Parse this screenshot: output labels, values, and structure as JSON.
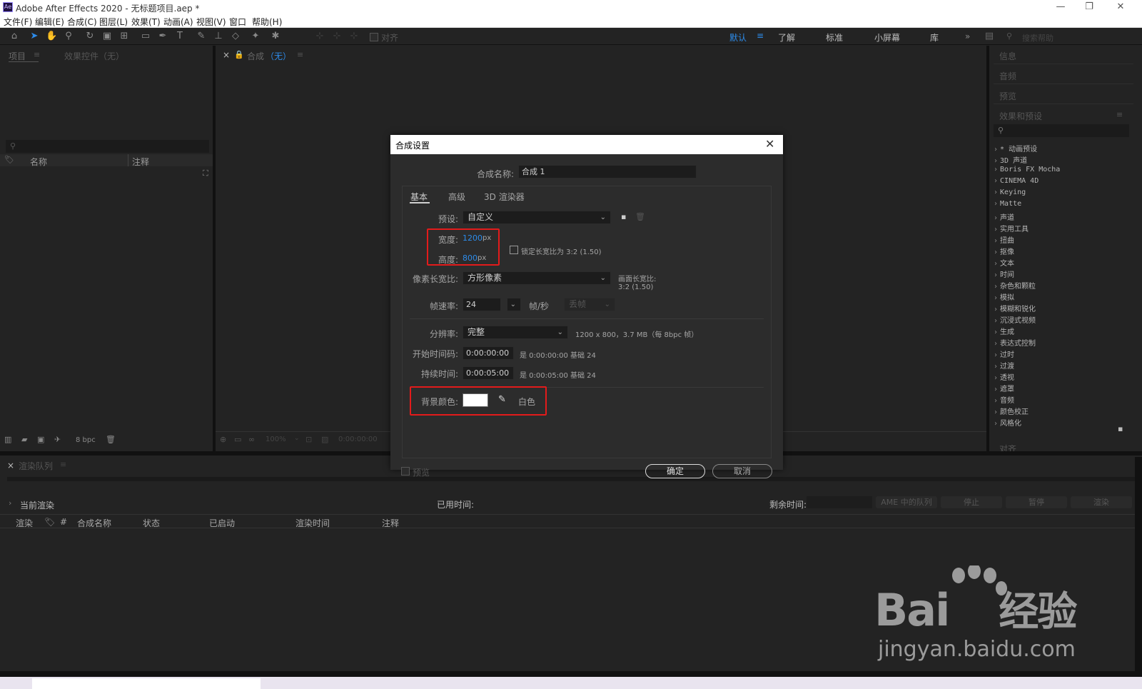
{
  "window": {
    "title": "Adobe After Effects 2020 - 无标题项目.aep *",
    "logo": "Ae"
  },
  "menu": [
    "文件(F)",
    "编辑(E)",
    "合成(C)",
    "图层(L)",
    "效果(T)",
    "动画(A)",
    "视图(V)",
    "窗口",
    "帮助(H)"
  ],
  "toolbar": {
    "align_label": "对齐",
    "workspaces": [
      "默认",
      "了解",
      "标准",
      "小屏幕",
      "库"
    ],
    "search_placeholder": "搜索帮助"
  },
  "project_panel": {
    "tab_project": "项目",
    "tab_effects": "效果控件（无）",
    "col_name": "名称",
    "col_comment": "注释",
    "bpc": "8 bpc"
  },
  "comp_panel": {
    "tab_label": "合成",
    "tab_value": "（无）",
    "zoom": "100%",
    "timecode": "0:00:00:00"
  },
  "right_panel": {
    "sections": [
      "信息",
      "音频",
      "预览"
    ],
    "effects_title": "效果和预设",
    "effects": [
      "* 动画预设",
      "3D 声道",
      "Boris FX Mocha",
      "CINEMA 4D",
      "Keying",
      "Matte",
      "声道",
      "实用工具",
      "扭曲",
      "抠像",
      "文本",
      "时间",
      "杂色和颗粒",
      "模拟",
      "模糊和锐化",
      "沉浸式视频",
      "生成",
      "表达式控制",
      "过时",
      "过渡",
      "透视",
      "遮罩",
      "音频",
      "颜色校正",
      "风格化"
    ],
    "align_section": "对齐"
  },
  "render_queue": {
    "tab": "渲染队列",
    "current_render": "当前渲染",
    "elapsed": "已用时间:",
    "remaining": "剩余时间:",
    "buttons": [
      "AME 中的队列",
      "停止",
      "暂停",
      "渲染"
    ],
    "columns": [
      "渲染",
      "#",
      "合成名称",
      "状态",
      "已启动",
      "渲染时间",
      "注释"
    ]
  },
  "dialog": {
    "title": "合成设置",
    "name_label": "合成名称:",
    "name_value": "合成 1",
    "tabs": [
      "基本",
      "高级",
      "3D 渲染器"
    ],
    "preset_label": "预设:",
    "preset_value": "自定义",
    "width_label": "宽度:",
    "width_value": "1200",
    "height_label": "高度:",
    "height_value": "800",
    "unit": "px",
    "lock_label": "锁定长宽比为 3:2 (1.50)",
    "pixel_aspect_label": "像素长宽比:",
    "pixel_aspect_value": "方形像素",
    "frame_aspect_label": "画面长宽比:",
    "frame_aspect_value": "3:2 (1.50)",
    "fps_label": "帧速率:",
    "fps_value": "24",
    "fps_unit": "帧/秒",
    "drop_frame": "丢帧",
    "resolution_label": "分辨率:",
    "resolution_value": "完整",
    "resolution_info": "1200 x 800，3.7 MB（每 8bpc 帧）",
    "start_label": "开始时间码:",
    "start_value": "0:00:00:00",
    "start_info": "是 0:00:00:00  基础 24",
    "duration_label": "持续时间:",
    "duration_value": "0:00:05:00",
    "duration_info": "是 0:00:05:00  基础 24",
    "bg_label": "背景颜色:",
    "bg_name": "白色",
    "bg_color": "#ffffff",
    "preview_label": "预览",
    "ok": "确定",
    "cancel": "取消"
  },
  "watermark": {
    "brand": "Bai",
    "brand2": "经验",
    "url": "jingyan.baidu.com"
  }
}
